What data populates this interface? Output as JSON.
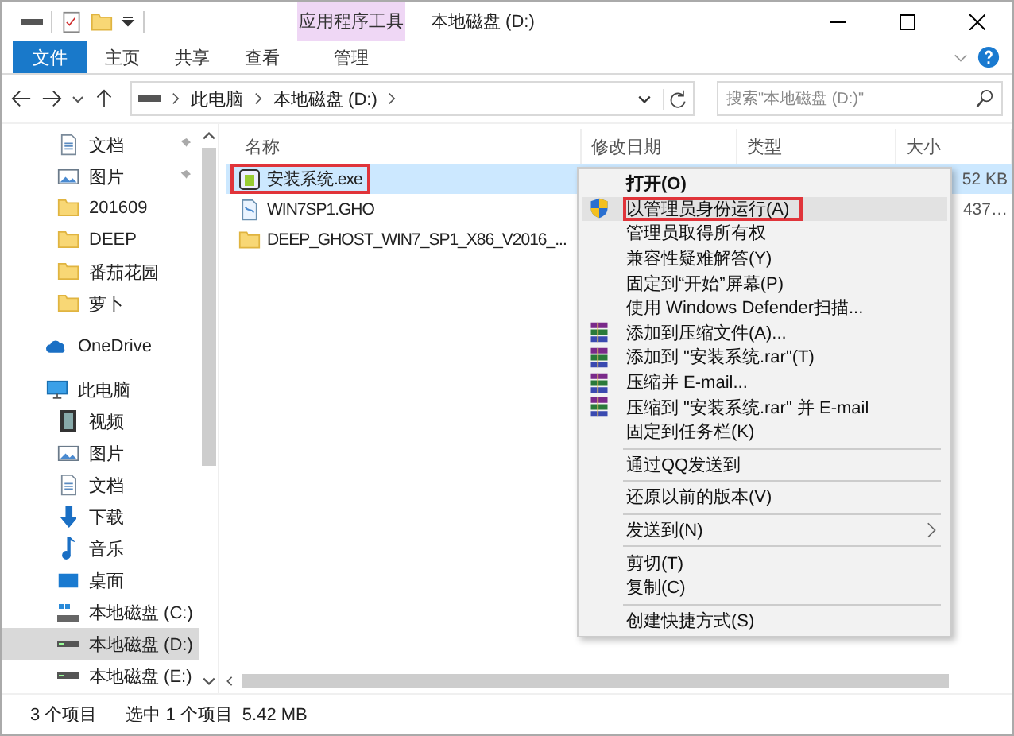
{
  "window": {
    "title": "本地磁盘 (D:)",
    "context_group": "应用程序工具"
  },
  "ribbon_tabs": [
    {
      "label": "文件",
      "kind": "file"
    },
    {
      "label": "主页",
      "kind": "normal"
    },
    {
      "label": "共享",
      "kind": "normal"
    },
    {
      "label": "查看",
      "kind": "normal"
    },
    {
      "label": "管理",
      "kind": "context"
    }
  ],
  "address": {
    "crumbs": [
      "此电脑",
      "本地磁盘 (D:)"
    ]
  },
  "search": {
    "placeholder": "搜索\"本地磁盘 (D:)\""
  },
  "sidebar": {
    "quick_access": [
      {
        "label": "文档",
        "kind": "doc",
        "pinned": true
      },
      {
        "label": "图片",
        "kind": "picture",
        "pinned": true
      },
      {
        "label": "201609",
        "kind": "folder",
        "pinned": false
      },
      {
        "label": "DEEP",
        "kind": "folder",
        "pinned": false
      },
      {
        "label": "番茄花园",
        "kind": "folder",
        "pinned": false
      },
      {
        "label": "萝卜",
        "kind": "folder",
        "pinned": false
      }
    ],
    "items": [
      {
        "label": "OneDrive",
        "kind": "cloud",
        "selected": false
      },
      {
        "label": "此电脑",
        "kind": "pc",
        "selected": false,
        "children": [
          {
            "label": "视频",
            "kind": "video",
            "selected": false
          },
          {
            "label": "图片",
            "kind": "picture",
            "selected": false
          },
          {
            "label": "文档",
            "kind": "doc",
            "selected": false
          },
          {
            "label": "下载",
            "kind": "download",
            "selected": false
          },
          {
            "label": "音乐",
            "kind": "music",
            "selected": false
          },
          {
            "label": "桌面",
            "kind": "desktop",
            "selected": false
          },
          {
            "label": "本地磁盘 (C:)",
            "kind": "systemdrive",
            "selected": false
          },
          {
            "label": "本地磁盘 (D:)",
            "kind": "drive",
            "selected": true
          },
          {
            "label": "本地磁盘 (E:)",
            "kind": "drive",
            "selected": false
          }
        ]
      }
    ]
  },
  "table": {
    "columns": [
      "名称",
      "修改日期",
      "类型",
      "大小"
    ],
    "rows": [
      {
        "name": "安装系统.exe",
        "kind": "exe",
        "selected": true,
        "outlined": true,
        "size": "52 KB"
      },
      {
        "name": "WIN7SP1.GHO",
        "kind": "gho",
        "selected": false,
        "outlined": false,
        "size": "437…"
      },
      {
        "name": "DEEP_GHOST_WIN7_SP1_X86_V2016_...",
        "kind": "folder",
        "selected": false,
        "outlined": false
      }
    ]
  },
  "context_menu": [
    {
      "kind": "plain",
      "label": "打开(O)",
      "bold": true,
      "selected": false,
      "outlined": false,
      "submenu": false
    },
    {
      "kind": "shield",
      "label": "以管理员身份运行(A)",
      "bold": false,
      "selected": true,
      "outlined": true,
      "submenu": false
    },
    {
      "kind": "plain",
      "label": "管理员取得所有权",
      "bold": false,
      "selected": false,
      "outlined": false,
      "submenu": false
    },
    {
      "kind": "plain",
      "label": "兼容性疑难解答(Y)",
      "bold": false,
      "selected": false,
      "outlined": false,
      "submenu": false
    },
    {
      "kind": "plain",
      "label": "固定到“开始”屏幕(P)",
      "bold": false,
      "selected": false,
      "outlined": false,
      "submenu": false
    },
    {
      "kind": "plain",
      "label": "使用 Windows Defender扫描...",
      "bold": false,
      "selected": false,
      "outlined": false,
      "submenu": false
    },
    {
      "kind": "archive",
      "label": "添加到压缩文件(A)...",
      "bold": false,
      "selected": false,
      "outlined": false,
      "submenu": false
    },
    {
      "kind": "archive",
      "label": "添加到 \"安装系统.rar\"(T)",
      "bold": false,
      "selected": false,
      "outlined": false,
      "submenu": false
    },
    {
      "kind": "archive",
      "label": "压缩并 E-mail...",
      "bold": false,
      "selected": false,
      "outlined": false,
      "submenu": false
    },
    {
      "kind": "archive",
      "label": "压缩到 \"安装系统.rar\" 并 E-mail",
      "bold": false,
      "selected": false,
      "outlined": false,
      "submenu": false
    },
    {
      "kind": "plain",
      "label": "固定到任务栏(K)",
      "bold": false,
      "selected": false,
      "outlined": false,
      "submenu": false
    },
    {
      "kind": "separator"
    },
    {
      "kind": "plain",
      "label": "通过QQ发送到",
      "bold": false,
      "selected": false,
      "outlined": false,
      "submenu": false
    },
    {
      "kind": "separator"
    },
    {
      "kind": "plain",
      "label": "还原以前的版本(V)",
      "bold": false,
      "selected": false,
      "outlined": false,
      "submenu": false
    },
    {
      "kind": "separator"
    },
    {
      "kind": "plain",
      "label": "发送到(N)",
      "bold": false,
      "selected": false,
      "outlined": false,
      "submenu": true
    },
    {
      "kind": "separator"
    },
    {
      "kind": "plain",
      "label": "剪切(T)",
      "bold": false,
      "selected": false,
      "outlined": false,
      "submenu": false
    },
    {
      "kind": "plain",
      "label": "复制(C)",
      "bold": false,
      "selected": false,
      "outlined": false,
      "submenu": false
    },
    {
      "kind": "separator"
    },
    {
      "kind": "plain",
      "label": "创建快捷方式(S)",
      "bold": false,
      "selected": false,
      "outlined": false,
      "submenu": false
    }
  ],
  "status_bar": [
    "3 个项目",
    "选中 1 个项目",
    "5.42 MB"
  ]
}
